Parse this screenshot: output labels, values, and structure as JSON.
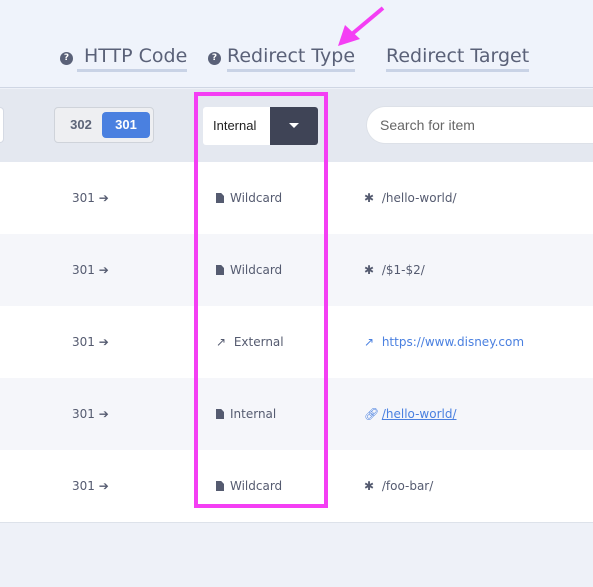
{
  "header": {
    "columns": [
      {
        "label": "HTTP Code",
        "help_icon": "question-circle-icon"
      },
      {
        "label": "Redirect Type",
        "help_icon": "question-circle-icon"
      },
      {
        "label": "Redirect Target"
      }
    ]
  },
  "toolbar": {
    "http_toggle": {
      "options": [
        "302",
        "301"
      ],
      "selected": "301"
    },
    "type_select": {
      "value": "Internal"
    },
    "search": {
      "placeholder": "Search for item"
    }
  },
  "rows": [
    {
      "code": "301",
      "type": "Wildcard",
      "type_icon": "file-icon",
      "target": "/hello-world/",
      "target_icon": "asterisk-icon"
    },
    {
      "code": "301",
      "type": "Wildcard",
      "type_icon": "file-icon",
      "target": "/$1-$2/",
      "target_icon": "asterisk-icon"
    },
    {
      "code": "301",
      "type": "External",
      "type_icon": "external-link-icon",
      "target": "https://www.disney.com",
      "target_icon": "external-link-icon"
    },
    {
      "code": "301",
      "type": "Internal",
      "type_icon": "file-icon",
      "target": "/hello-world/",
      "target_icon": "link-icon"
    },
    {
      "code": "301",
      "type": "Wildcard",
      "type_icon": "file-icon",
      "target": "/foo-bar/",
      "target_icon": "asterisk-icon"
    }
  ],
  "colors": {
    "accent": "#4a80e0",
    "annotation": "#f43ef4",
    "select_button": "#3f4456"
  }
}
